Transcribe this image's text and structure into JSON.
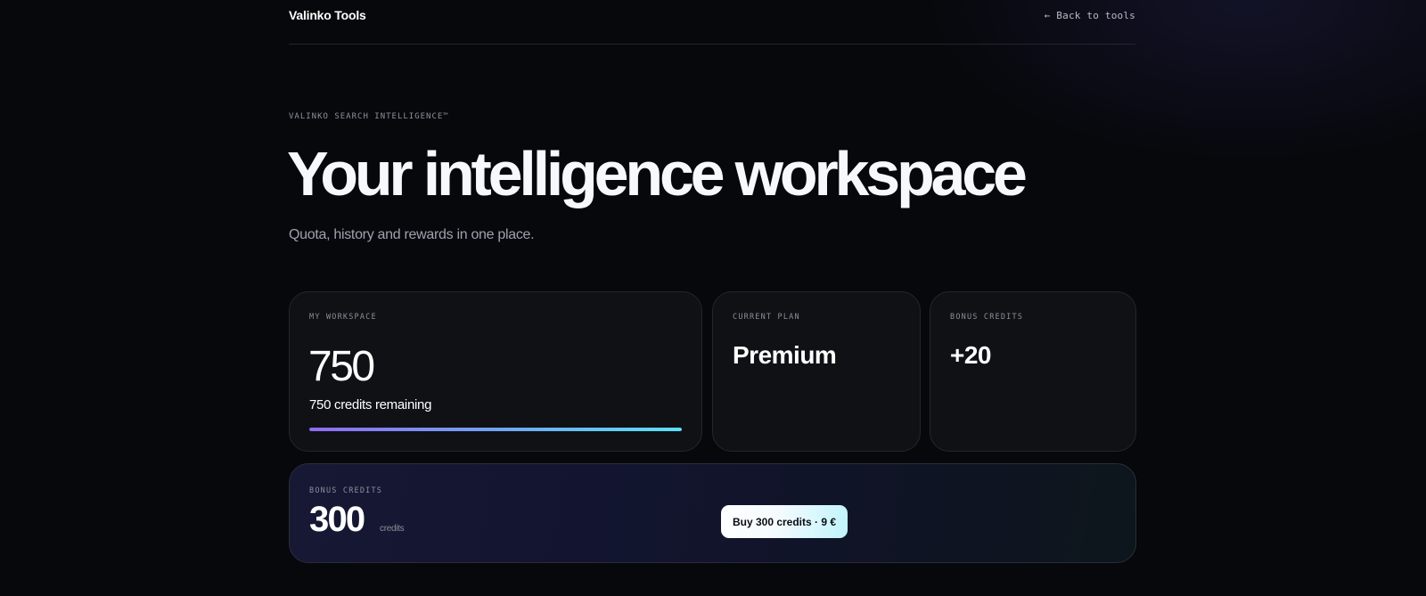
{
  "header": {
    "brand": "Valinko Tools",
    "back_link": "← Back to tools"
  },
  "hero": {
    "eyebrow": "VALINKO SEARCH INTELLIGENCE™",
    "title": "Your intelligence workspace",
    "subtitle": "Quota, history and rewards in one place."
  },
  "workspace_card": {
    "label": "MY WORKSPACE",
    "credits": "750",
    "remaining_text": "750 credits remaining",
    "progress_fraction": 1.0
  },
  "plan_card": {
    "label": "CURRENT PLAN",
    "value": "Premium"
  },
  "bonus_card": {
    "label": "BONUS CREDITS",
    "value": "+20"
  },
  "buy_card": {
    "label": "BONUS CREDITS",
    "amount": "300",
    "unit": "credits",
    "button_label": "Buy 300 credits · 9 €"
  },
  "colors": {
    "background": "#07080c",
    "card": "#101115",
    "progress_start": "#8f6cf2",
    "progress_end": "#5de0f5",
    "button_end": "#bff4fb"
  }
}
